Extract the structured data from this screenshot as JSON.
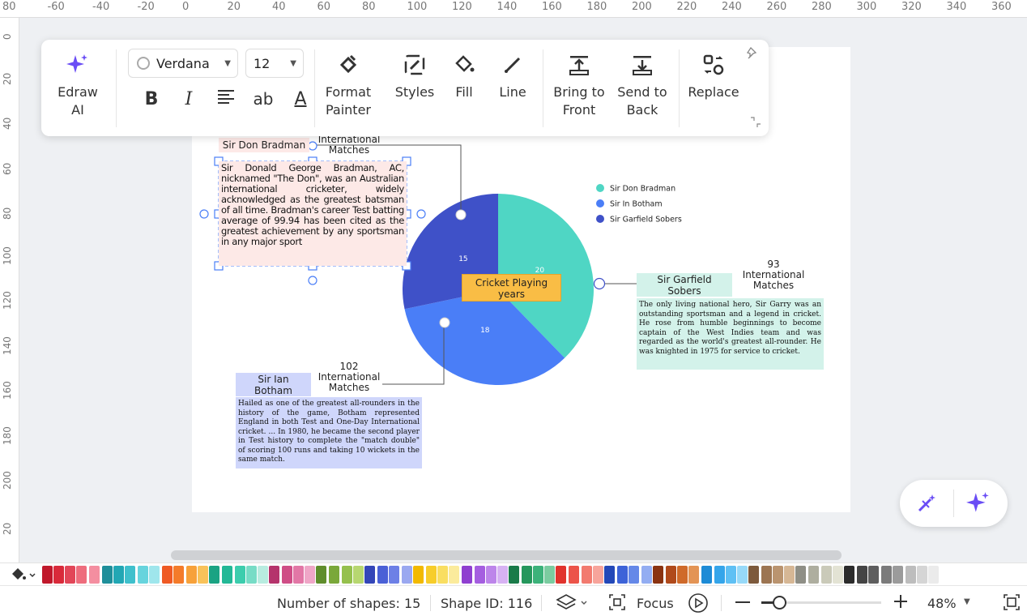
{
  "rulers": {
    "top": [
      "80",
      "-60",
      "-40",
      "-20",
      "0",
      "20",
      "40",
      "60",
      "80",
      "100",
      "120",
      "140",
      "160",
      "180",
      "200",
      "220",
      "240",
      "260",
      "280",
      "300",
      "320",
      "340",
      "360"
    ],
    "left": [
      "0",
      "20",
      "40",
      "60",
      "80",
      "100",
      "120",
      "140",
      "160",
      "180",
      "200",
      "20"
    ]
  },
  "toolbar": {
    "edraw_ai": "Edraw AI",
    "font": "Verdana",
    "font_size": "12",
    "bold": "B",
    "italic": "I",
    "strike": "ab",
    "underline_a": "A",
    "format_painter": [
      "Format",
      "Painter"
    ],
    "styles": "Styles",
    "fill": "Fill",
    "line": "Line",
    "bring_to_front": [
      "Bring to",
      "Front"
    ],
    "send_to_back": [
      "Send to",
      "Back"
    ],
    "replace": "Replace"
  },
  "diagram": {
    "center_label": [
      "Cricket Playing",
      "years"
    ],
    "bradman": {
      "name": "Sir Don Bradman",
      "matches": [
        "International",
        "Matches"
      ],
      "paragraph": "Sir Donald George Bradman, AC, nicknamed \"The Don\", was an Australian international cricketer, widely acknowledged as the greatest batsman of all time. Bradman's career Test batting average of 99.94 has been cited as the greatest achievement by any sportsman in any major sport"
    },
    "botham": {
      "name": [
        "Sir Ian",
        "Botham"
      ],
      "count": "102",
      "matches": [
        "International",
        "Matches"
      ],
      "paragraph": "Hailed as one of the greatest all-rounders in the history of the game, Botham represented England in both Test and One-Day International cricket. ... In 1980, he became the second player in Test history to complete the \"match double\" of scoring 100 runs and taking 10 wickets in the same match."
    },
    "sobers": {
      "name": [
        "Sir Garfield",
        "Sobers"
      ],
      "count": "93",
      "matches": [
        "International",
        "Matches"
      ],
      "paragraph": "The only living national hero, Sir Garry was an outstanding sportsman and a legend in cricket. He rose from humble beginnings to become captain of the West Indies team and was regarded as the world's greatest all-rounder. He was knighted in 1975 for service to cricket."
    }
  },
  "chart_data": {
    "type": "pie",
    "categories": [
      "Sir Don Bradman",
      "Sir In Botham",
      "Sir Garfield Sobers"
    ],
    "values": [
      20,
      18,
      15
    ],
    "colors": [
      "#4fd6c4",
      "#4a7ef7",
      "#3f51c8"
    ],
    "legend_position": "top-right"
  },
  "status": {
    "shapes": "Number of shapes: 15",
    "shape_id": "Shape ID: 116",
    "focus": "Focus",
    "zoom": "48%"
  },
  "palette": [
    "#c0182b",
    "#d92a3a",
    "#e24658",
    "#ee6d7d",
    "#f48ea0",
    "#1f8f9a",
    "#22a7b4",
    "#3fc0cc",
    "#67d4dd",
    "#9fe6ec",
    "#ef5a24",
    "#f47b2a",
    "#f7a13a",
    "#f8c25a",
    "#1aa383",
    "#23b896",
    "#3ccdad",
    "#77dcc6",
    "#b8ece0",
    "#b5336c",
    "#cf4d86",
    "#e277a6",
    "#efa6c7",
    "#5f8d2c",
    "#7aa83a",
    "#95c04d",
    "#b7d770",
    "#3446b8",
    "#4a60d6",
    "#6d80e6",
    "#9aa8f0",
    "#f2b900",
    "#f7cd2a",
    "#f9de61",
    "#fbeb9c",
    "#8f3fd0",
    "#a55ee0",
    "#bd85ea",
    "#d7b2f3",
    "#1a7b49",
    "#25975c",
    "#3cb27a",
    "#7bcca0",
    "#e1332d",
    "#ec5449",
    "#f27a6f",
    "#f7a49b",
    "#2348b8",
    "#3d63d8",
    "#6588e8",
    "#93adf2",
    "#8a3311",
    "#b04a1b",
    "#cf6a2a",
    "#e39455",
    "#1d8bd6",
    "#35a5ea",
    "#5fc0f4",
    "#97d9f8",
    "#7d5a3c",
    "#9c7552",
    "#ba946f",
    "#d6b795",
    "#8f8f86",
    "#aeae9f",
    "#cacab9",
    "#e3e3d4",
    "#2b2b2b",
    "#444444",
    "#5e5e5e",
    "#7b7b7b",
    "#9b9b9b",
    "#bdbdbd",
    "#d5d5d5",
    "#ebebeb"
  ]
}
